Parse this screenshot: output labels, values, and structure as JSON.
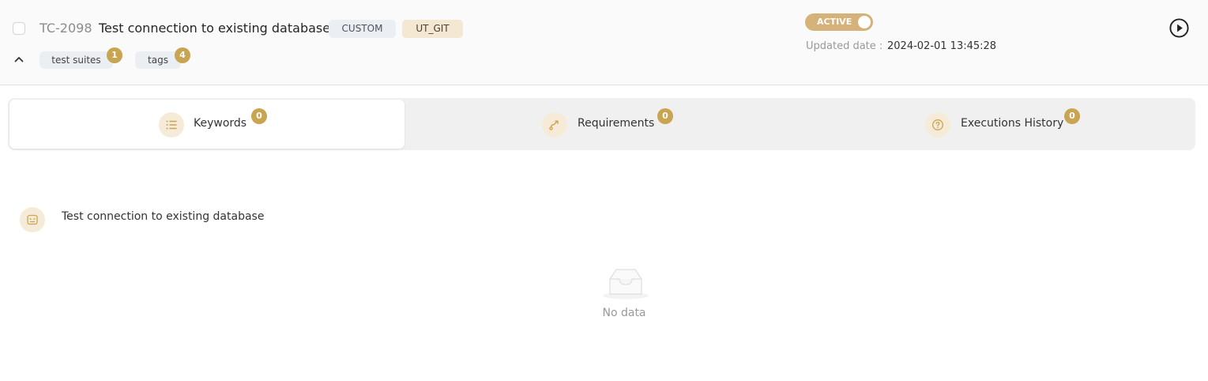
{
  "test_case": {
    "id": "TC-2098",
    "title": "Test connection to existing database",
    "type_label": "CUSTOM",
    "source_label": "UT_GIT",
    "test_suites_label": "test suites",
    "test_suites_count": "1",
    "tags_label": "tags",
    "tags_count": "4",
    "status_label": "ACTIVE",
    "status_active": true,
    "updated_label": "Updated date :",
    "updated_value": "2024-02-01 13:45:28"
  },
  "tabs": [
    {
      "label": "Keywords",
      "count": "0",
      "icon": "list-icon",
      "active": true
    },
    {
      "label": "Requirements",
      "count": "0",
      "icon": "route-icon",
      "active": false
    },
    {
      "label": "Executions History",
      "count": "0",
      "icon": "help-circle-icon",
      "active": false
    }
  ],
  "keywords": {
    "title": "Test connection to existing database",
    "icon": "robot-icon",
    "empty_text": "No data"
  },
  "colors": {
    "accent": "#c9a451",
    "toggle_bg": "#d5b27a",
    "icon_bg": "#f6ebd9",
    "chip_bg": "#ebeef2"
  }
}
